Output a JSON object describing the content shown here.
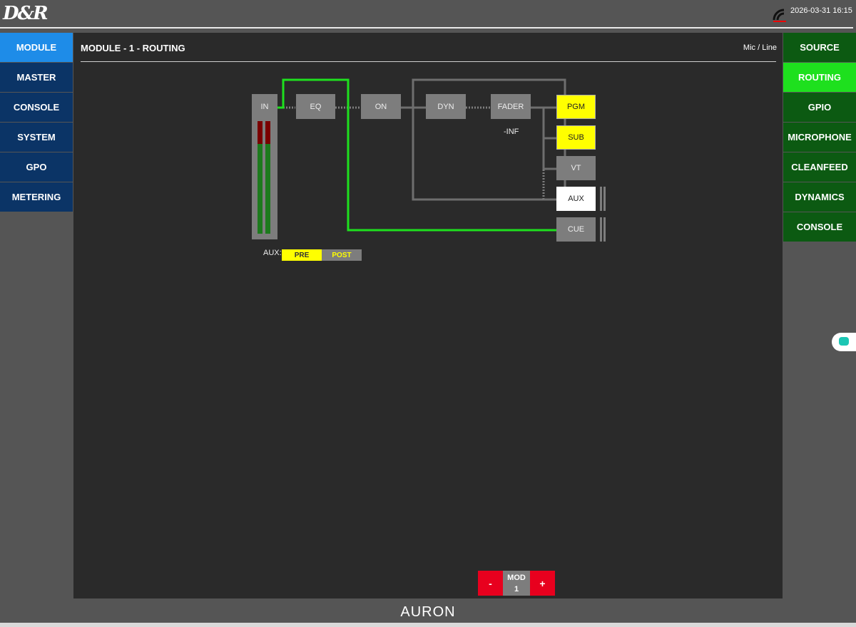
{
  "header": {
    "logo": "D&R",
    "datetime": "2026-03-31 16:15",
    "status_icon": "connection-arc-icon"
  },
  "left_menu": [
    {
      "label": "MODULE",
      "active": true
    },
    {
      "label": "MASTER",
      "active": false
    },
    {
      "label": "CONSOLE",
      "active": false
    },
    {
      "label": "SYSTEM",
      "active": false
    },
    {
      "label": "GPO",
      "active": false
    },
    {
      "label": "METERING",
      "active": false
    }
  ],
  "right_menu": [
    {
      "label": "SOURCE",
      "active": false
    },
    {
      "label": "ROUTING",
      "active": true
    },
    {
      "label": "GPIO",
      "active": false
    },
    {
      "label": "MICROPHONE",
      "active": false
    },
    {
      "label": "CLEANFEED",
      "active": false
    },
    {
      "label": "DYNAMICS",
      "active": false
    },
    {
      "label": "CONSOLE",
      "active": false
    }
  ],
  "main": {
    "title": "MODULE - 1 - ROUTING",
    "source_type": "Mic / Line",
    "chain": {
      "in": "IN",
      "eq": "EQ",
      "on": "ON",
      "dyn": "DYN",
      "fader": "FADER",
      "fader_value": "-INF"
    },
    "outputs": {
      "pgm": "PGM",
      "sub": "SUB",
      "vt": "VT",
      "aux": "AUX",
      "cue": "CUE"
    },
    "aux_mode": {
      "label": "AUX:",
      "pre": "PRE",
      "post": "POST",
      "selected": "PRE"
    },
    "meter": {
      "left_level": 0.84,
      "right_level": 0.84
    },
    "module_selector": {
      "minus": "-",
      "label": "MOD",
      "value": "1",
      "plus": "+"
    }
  },
  "colors": {
    "signal_active": "#1ee01e",
    "routed_on": "#ffff00",
    "menu_left": "#0b3466",
    "menu_left_active": "#1e8ce8",
    "menu_right": "#0c5a12",
    "menu_right_active": "#1ee01e"
  },
  "footer": {
    "brand": "AURON"
  }
}
